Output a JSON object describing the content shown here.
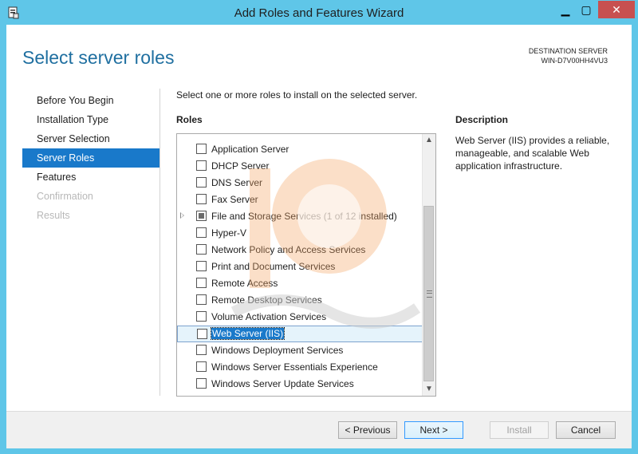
{
  "window": {
    "title": "Add Roles and Features Wizard",
    "controls": {
      "minimize": "▁",
      "maximize": "▢",
      "close": "✕"
    }
  },
  "header": {
    "page_title": "Select server roles",
    "destination_label": "DESTINATION SERVER",
    "destination_server": "WIN-D7V00HH4VU3"
  },
  "nav": {
    "items": [
      {
        "label": "Before You Begin",
        "state": "normal"
      },
      {
        "label": "Installation Type",
        "state": "normal"
      },
      {
        "label": "Server Selection",
        "state": "normal"
      },
      {
        "label": "Server Roles",
        "state": "active"
      },
      {
        "label": "Features",
        "state": "normal"
      },
      {
        "label": "Confirmation",
        "state": "disabled"
      },
      {
        "label": "Results",
        "state": "disabled"
      }
    ]
  },
  "main": {
    "instruction": "Select one or more roles to install on the selected server.",
    "roles_heading": "Roles",
    "roles": [
      {
        "label": "Application Server",
        "checked": false
      },
      {
        "label": "DHCP Server",
        "checked": false
      },
      {
        "label": "DNS Server",
        "checked": false
      },
      {
        "label": "Fax Server",
        "checked": false
      },
      {
        "label": "File and Storage Services (1 of 12 installed)",
        "checked": "partial",
        "expandable": true
      },
      {
        "label": "Hyper-V",
        "checked": false
      },
      {
        "label": "Network Policy and Access Services",
        "checked": false
      },
      {
        "label": "Print and Document Services",
        "checked": false
      },
      {
        "label": "Remote Access",
        "checked": false
      },
      {
        "label": "Remote Desktop Services",
        "checked": false
      },
      {
        "label": "Volume Activation Services",
        "checked": false
      },
      {
        "label": "Web Server (IIS)",
        "checked": false,
        "selected": true
      },
      {
        "label": "Windows Deployment Services",
        "checked": false
      },
      {
        "label": "Windows Server Essentials Experience",
        "checked": false
      },
      {
        "label": "Windows Server Update Services",
        "checked": false
      }
    ],
    "scroll_arrows": {
      "up": "▲",
      "down": "▼"
    }
  },
  "description": {
    "heading": "Description",
    "text": "Web Server (IIS) provides a reliable, manageable, and scalable Web application infrastructure."
  },
  "footer": {
    "previous_label": "< Previous",
    "next_label": "Next >",
    "install_label": "Install",
    "cancel_label": "Cancel"
  },
  "colors": {
    "frame": "#5fc6e8",
    "accent": "#1979ca",
    "title_text": "#1f6fa0",
    "watermark": "#f4a460"
  }
}
